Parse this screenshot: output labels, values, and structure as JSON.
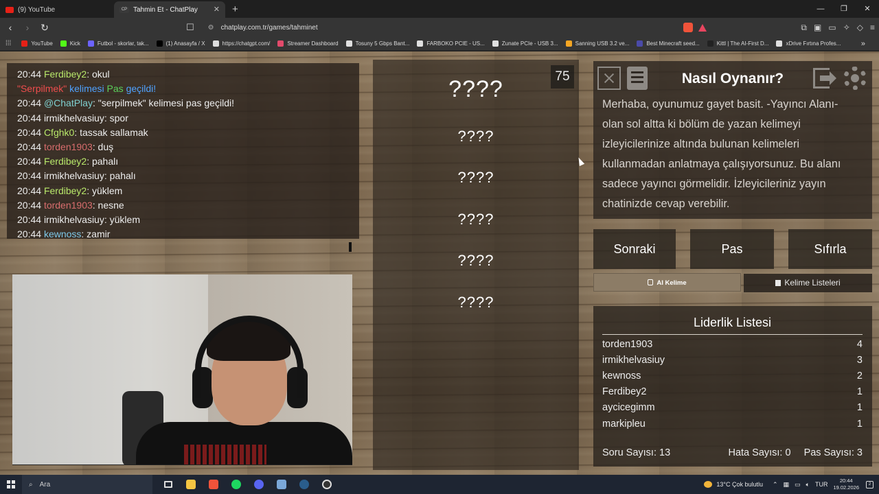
{
  "browser": {
    "tabs": [
      {
        "label": "(9) YouTube",
        "icon": "youtube-icon"
      },
      {
        "label": "Tahmin Et - ChatPlay",
        "icon": "chatplay-icon",
        "active": true
      }
    ],
    "url": "chatplay.com.tr/games/tahminet",
    "bookmarks": [
      {
        "label": "YouTube",
        "color": "#e62117"
      },
      {
        "label": "Kick",
        "color": "#53fc18"
      },
      {
        "label": "Futbol - skorlar, tak...",
        "color": "#6c63ff"
      },
      {
        "label": "(1) Anasayfa / X",
        "color": "#000000"
      },
      {
        "label": "https://chatgpt.com/",
        "color": "#dddddd"
      },
      {
        "label": "Streamer Dashboard",
        "color": "#e24a6b"
      },
      {
        "label": "Tosuny 5 Gbps Bant...",
        "color": "#e0e0e0"
      },
      {
        "label": "FARBOKO PCIE - US...",
        "color": "#e0e0e0"
      },
      {
        "label": "Zunate PCIe - USB 3...",
        "color": "#e0e0e0"
      },
      {
        "label": "Sanning USB 3.2 ve...",
        "color": "#f5a623"
      },
      {
        "label": "Best Minecraft seed...",
        "color": "#4a4aa8"
      },
      {
        "label": "Kittl | The AI-First D...",
        "color": "#222222"
      },
      {
        "label": "xDrive Fırtına Profes...",
        "color": "#e0e0e0"
      }
    ]
  },
  "chat": [
    {
      "time": "20:44",
      "user": "Ferdibey2",
      "user_color": "c-lime",
      "text": ": okul"
    },
    {
      "system": true,
      "parts": [
        {
          "text": "\"Serpilmek\" ",
          "color": "c-sys-red"
        },
        {
          "text": "kelimesi ",
          "color": "c-sys-blue"
        },
        {
          "text": "Pas ",
          "color": "c-sys-green"
        },
        {
          "text": "geçildi!",
          "color": "c-sys-blue"
        }
      ]
    },
    {
      "time": "20:44",
      "user": "@ChatPlay",
      "user_color": "c-teal",
      "text": ": \"serpilmek\" kelimesi pas geçildi!"
    },
    {
      "time": "20:44",
      "user": "irmikhelvasiuy",
      "user_color": "",
      "text": ": spor"
    },
    {
      "time": "20:44",
      "user": "Cfghk0",
      "user_color": "c-lime",
      "text": ": tassak sallamak"
    },
    {
      "time": "20:44",
      "user": "torden1903",
      "user_color": "c-rose",
      "text": ": duş"
    },
    {
      "time": "20:44",
      "user": "Ferdibey2",
      "user_color": "c-lime",
      "text": ": pahalı"
    },
    {
      "time": "20:44",
      "user": "irmikhelvasiuy",
      "user_color": "",
      "text": ": pahalı"
    },
    {
      "time": "20:44",
      "user": "Ferdibey2",
      "user_color": "c-lime",
      "text": ": yüklem"
    },
    {
      "time": "20:44",
      "user": "torden1903",
      "user_color": "c-rose",
      "text": ": nesne"
    },
    {
      "time": "20:44",
      "user": "irmikhelvasiuy",
      "user_color": "",
      "text": ": yüklem"
    },
    {
      "time": "20:44",
      "user": "kewnoss",
      "user_color": "c-cyan",
      "text": ": zamir"
    }
  ],
  "game": {
    "timer": "75",
    "main_word": "????",
    "forbidden_words": [
      "????",
      "????",
      "????",
      "????",
      "????"
    ]
  },
  "howto": {
    "title": "Nasıl Oynanır?",
    "text": "Merhaba, oyunumuz gayet basit. -Yayıncı Alanı- olan sol altta ki bölüm de yazan kelimeyi izleyicilerinize altında bulunan kelimeleri kullanmadan anlatmaya çalışıyorsunuz. Bu alanı sadece yayıncı görmelidir. İzleyicileriniz yayın chatinizde cevap verebilir."
  },
  "controls": {
    "next": "Sonraki",
    "pass": "Pas",
    "reset": "Sıfırla",
    "ai_word": "AI Kelime",
    "word_lists": "Kelime Listeleri"
  },
  "leaderboard": {
    "title": "Liderlik Listesi",
    "rows": [
      {
        "name": "torden1903",
        "score": "4"
      },
      {
        "name": "irmikhelvasiuy",
        "score": "3"
      },
      {
        "name": "kewnoss",
        "score": "2"
      },
      {
        "name": "Ferdibey2",
        "score": "1"
      },
      {
        "name": "aycicegimm",
        "score": "1"
      },
      {
        "name": "markipleu",
        "score": "1"
      }
    ],
    "questions": "Soru Sayısı: 13",
    "errors": "Hata Sayısı: 0",
    "passes": "Pas Sayısı: 3"
  },
  "taskbar": {
    "search_placeholder": "Ara",
    "weather": "13°C  Çok bulutlu",
    "lang": "TUR",
    "time": "20:44",
    "date": "19.02.2026",
    "notif_count": "2"
  }
}
